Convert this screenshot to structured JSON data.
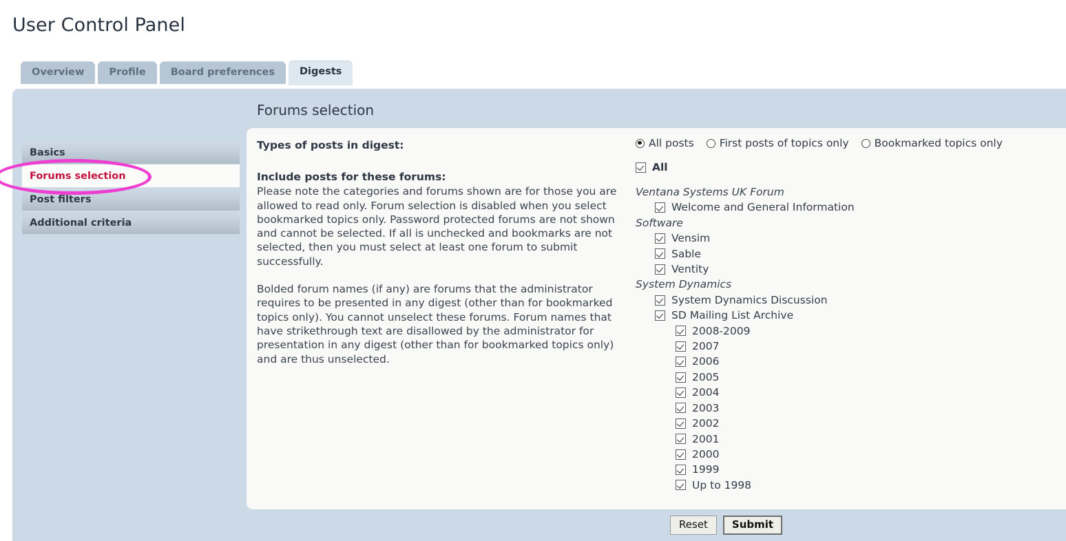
{
  "page": {
    "title": "User Control Panel"
  },
  "tabs": [
    {
      "label": "Overview",
      "active": false
    },
    {
      "label": "Profile",
      "active": false
    },
    {
      "label": "Board preferences",
      "active": false
    },
    {
      "label": "Digests",
      "active": true
    }
  ],
  "section": {
    "title": "Forums selection"
  },
  "sidenav": {
    "items": [
      {
        "label": "Basics",
        "active": false
      },
      {
        "label": "Forums selection",
        "active": true
      },
      {
        "label": "Post filters",
        "active": false
      },
      {
        "label": "Additional criteria",
        "active": false
      }
    ]
  },
  "annotation": {
    "shape": "ellipse",
    "color": "#ee3ed2",
    "target": "Forums selection"
  },
  "form": {
    "post_types_label": "Types of posts in digest:",
    "include_forums_label": "Include posts for these forums:",
    "paragraph_1": "Please note the categories and forums shown are for those you are allowed to read only. Forum selection is disabled when you select bookmarked topics only. Password protected forums are not shown and cannot be selected. If all is unchecked and bookmarks are not selected, then you must select at least one forum to submit successfully.",
    "paragraph_2": "Bolded forum names (if any) are forums that the administrator requires to be presented in any digest (other than for bookmarked topics only). You cannot unselect these forums. Forum names that have strikethrough text are disallowed by the administrator for presentation in any digest (other than for bookmarked topics only) and are thus unselected.",
    "post_type_options": [
      {
        "label": "All posts",
        "selected": true
      },
      {
        "label": "First posts of topics only",
        "selected": false
      },
      {
        "label": "Bookmarked topics only",
        "selected": false
      }
    ],
    "all_checkbox": {
      "label": "All",
      "checked": true
    }
  },
  "forum_tree": [
    {
      "category": "Ventana Systems UK Forum",
      "forums": [
        {
          "label": "Welcome and General Information",
          "checked": true,
          "level": 1
        }
      ]
    },
    {
      "category": "Software",
      "forums": [
        {
          "label": "Vensim",
          "checked": true,
          "level": 1
        },
        {
          "label": "Sable",
          "checked": true,
          "level": 1
        },
        {
          "label": "Ventity",
          "checked": true,
          "level": 1
        }
      ]
    },
    {
      "category": "System Dynamics",
      "forums": [
        {
          "label": "System Dynamics Discussion",
          "checked": true,
          "level": 1
        },
        {
          "label": "SD Mailing List Archive",
          "checked": true,
          "level": 1
        },
        {
          "label": "2008-2009",
          "checked": true,
          "level": 2
        },
        {
          "label": "2007",
          "checked": true,
          "level": 2
        },
        {
          "label": "2006",
          "checked": true,
          "level": 2
        },
        {
          "label": "2005",
          "checked": true,
          "level": 2
        },
        {
          "label": "2004",
          "checked": true,
          "level": 2
        },
        {
          "label": "2003",
          "checked": true,
          "level": 2
        },
        {
          "label": "2002",
          "checked": true,
          "level": 2
        },
        {
          "label": "2001",
          "checked": true,
          "level": 2
        },
        {
          "label": "2000",
          "checked": true,
          "level": 2
        },
        {
          "label": "1999",
          "checked": true,
          "level": 2
        },
        {
          "label": "Up to 1998",
          "checked": true,
          "level": 2
        }
      ]
    }
  ],
  "footer": {
    "reset_label": "Reset",
    "submit_label": "Submit"
  }
}
